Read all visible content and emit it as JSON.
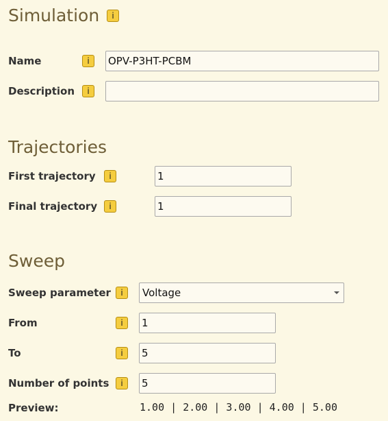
{
  "simulation": {
    "title": "Simulation",
    "info_icon": "i",
    "name": {
      "label": "Name",
      "value": "OPV-P3HT-PCBM"
    },
    "description": {
      "label": "Description",
      "value": ""
    }
  },
  "trajectories": {
    "title": "Trajectories",
    "first": {
      "label": "First trajectory",
      "value": "1"
    },
    "final": {
      "label": "Final trajectory",
      "value": "1"
    }
  },
  "sweep": {
    "title": "Sweep",
    "parameter": {
      "label": "Sweep parameter",
      "value": "Voltage"
    },
    "from": {
      "label": "From",
      "value": "1"
    },
    "to": {
      "label": "To",
      "value": "5"
    },
    "points": {
      "label": "Number of points",
      "value": "5"
    },
    "preview": {
      "label": "Preview:",
      "value": "1.00 | 2.00 | 3.00 | 4.00 | 5.00"
    }
  },
  "colors": {
    "background": "#fcf8e4",
    "section_title": "#6e5e37",
    "info_badge": "#f5cd3f"
  }
}
